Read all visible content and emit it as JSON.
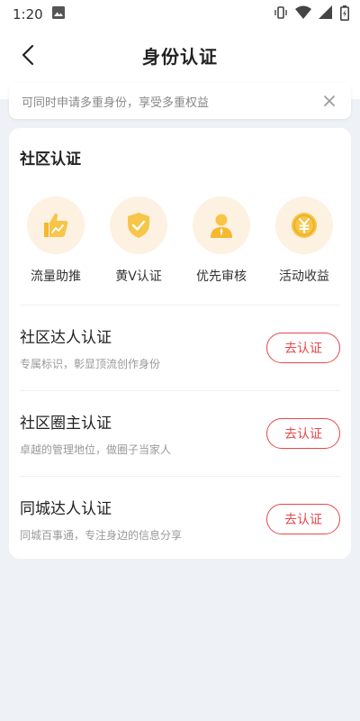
{
  "status_bar": {
    "time": "1:20"
  },
  "header": {
    "title": "身份认证"
  },
  "notice": {
    "text": "可同时申请多重身份，享受多重权益"
  },
  "card": {
    "title": "社区认证",
    "benefits": [
      {
        "label": "流量助推",
        "icon": "thumbs-up-chart-icon"
      },
      {
        "label": "黄V认证",
        "icon": "shield-check-icon"
      },
      {
        "label": "优先审核",
        "icon": "person-icon"
      },
      {
        "label": "活动收益",
        "icon": "yen-coin-icon"
      }
    ],
    "certifications": [
      {
        "title": "社区达人认证",
        "desc": "专属标识，彰显顶流创作身份",
        "button": "去认证"
      },
      {
        "title": "社区圈主认证",
        "desc": "卓越的管理地位，做圈子当家人",
        "button": "去认证"
      },
      {
        "title": "同城达人认证",
        "desc": "同城百事通，专注身边的信息分享",
        "button": "去认证"
      }
    ]
  },
  "colors": {
    "accent": "#e8474b",
    "icon_gold": "#f5b82e",
    "icon_bg": "#fdf1e2",
    "page_bg": "#eef1f5"
  }
}
